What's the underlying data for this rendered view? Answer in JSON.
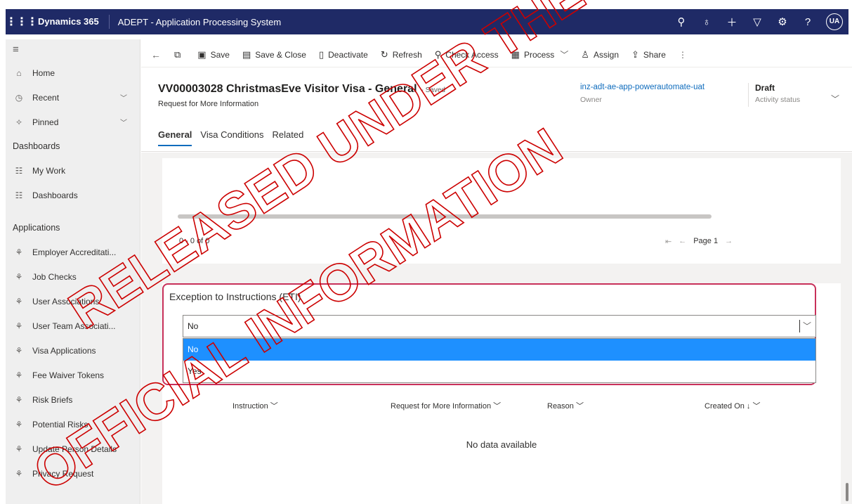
{
  "topbar": {
    "brand": "Dynamics 365",
    "app_name": "ADEPT - Application Processing System",
    "avatar_initials": "UA"
  },
  "nav": {
    "items_top": [
      {
        "label": "Home",
        "icon": "home-icon"
      },
      {
        "label": "Recent",
        "icon": "clock-icon"
      },
      {
        "label": "Pinned",
        "icon": "pin-icon"
      }
    ],
    "dashboards_header": "Dashboards",
    "dashboards": [
      {
        "label": "My Work",
        "icon": "list-icon"
      },
      {
        "label": "Dashboards",
        "icon": "list-icon"
      }
    ],
    "applications_header": "Applications",
    "applications": [
      {
        "label": "Employer Accreditati...",
        "icon": "puzzle-icon"
      },
      {
        "label": "Job Checks",
        "icon": "puzzle-icon"
      },
      {
        "label": "User Associations",
        "icon": "puzzle-icon"
      },
      {
        "label": "User Team Associati...",
        "icon": "puzzle-icon"
      },
      {
        "label": "Visa Applications",
        "icon": "puzzle-icon"
      },
      {
        "label": "Fee Waiver Tokens",
        "icon": "puzzle-icon"
      },
      {
        "label": "Risk Briefs",
        "icon": "puzzle-icon"
      },
      {
        "label": "Potential Risks",
        "icon": "puzzle-icon"
      },
      {
        "label": "Update Person Details",
        "icon": "puzzle-icon"
      },
      {
        "label": "Privacy Request",
        "icon": "puzzle-icon"
      }
    ]
  },
  "commands": {
    "save": "Save",
    "save_close": "Save & Close",
    "deactivate": "Deactivate",
    "refresh": "Refresh",
    "check_access": "Check Access",
    "process": "Process",
    "assign": "Assign",
    "share": "Share"
  },
  "record": {
    "title": "VV00003028 ChristmasEve Visitor Visa - General",
    "saved": "- Saved",
    "subtitle": "Request for More Information",
    "owner": "inz-adt-ae-app-powerautomate-uat",
    "owner_label": "Owner",
    "status": "Draft",
    "status_label": "Activity status"
  },
  "tabs": [
    "General",
    "Visa Conditions",
    "Related"
  ],
  "subgrid1": {
    "record_count": "0 - 0 of 0",
    "page_label": "Page 1"
  },
  "eti": {
    "label": "Exception to Instructions (ETI)",
    "value": "No",
    "options": [
      "No",
      "Yes"
    ]
  },
  "subgrid2": {
    "columns": [
      "Instruction",
      "Request for More Information",
      "Reason",
      "Created On"
    ],
    "empty_text": "No data available"
  },
  "watermark": {
    "line1": "RELEASED UNDER THE",
    "line2": "OFFICIAL INFORMATION",
    "color": "#cc0000"
  }
}
